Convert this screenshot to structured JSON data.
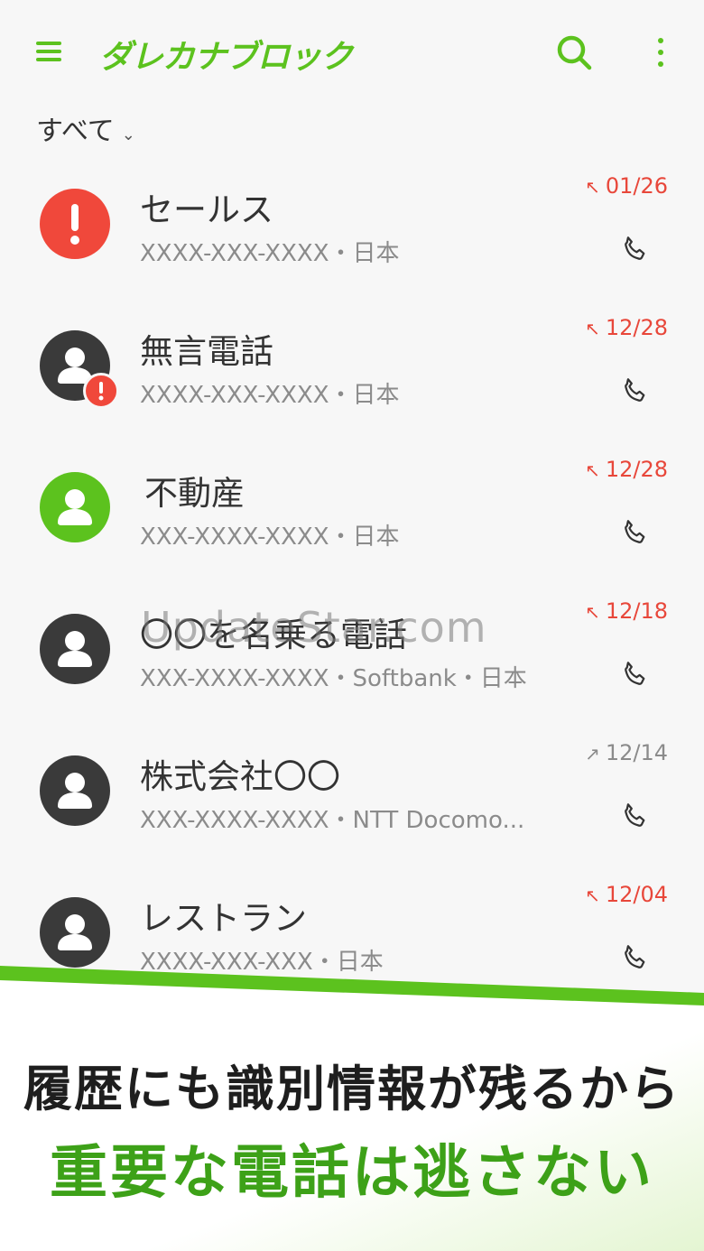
{
  "app": {
    "title": "ダレカナブロック"
  },
  "filter": {
    "label": "すべて",
    "chevron": "⌄"
  },
  "watermark": "UpdateStar.com",
  "calls": [
    {
      "name": "セールス",
      "detail": "XXXX-XXX-XXXX・日本",
      "date": "01/26",
      "type": "missed",
      "avatar": "warning"
    },
    {
      "name": "無言電話",
      "detail": "XXXX-XXX-XXXX・日本",
      "date": "12/28",
      "type": "missed",
      "avatar": "person-warning"
    },
    {
      "name": "不動産",
      "detail": "XXX-XXXX-XXXX・日本",
      "date": "12/28",
      "type": "missed",
      "avatar": "person-green"
    },
    {
      "name": "〇〇を名乗る電話",
      "detail": "XXX-XXXX-XXXX・Softbank・日本",
      "date": "12/18",
      "type": "missed",
      "avatar": "person"
    },
    {
      "name": "株式会社〇〇",
      "detail": "XXX-XXXX-XXXX・NTT Docomo...",
      "date": "12/14",
      "type": "outgoing",
      "avatar": "person"
    },
    {
      "name": "レストラン",
      "detail": "XXXX-XXX-XXX・日本",
      "date": "12/04",
      "type": "missed",
      "avatar": "person"
    }
  ],
  "promo": {
    "line1": "履歴にも識別情報が残るから",
    "line2": "重要な電話は逃さない"
  },
  "colors": {
    "brand": "#5cc21e",
    "missed": "#e8473a",
    "promo_green": "#3da118"
  },
  "icons": {
    "menu": "menu-icon",
    "search": "search-icon",
    "more": "more-vert-icon",
    "call": "phone-icon",
    "missed": "missed-call-icon",
    "outgoing": "outgoing-call-icon"
  }
}
